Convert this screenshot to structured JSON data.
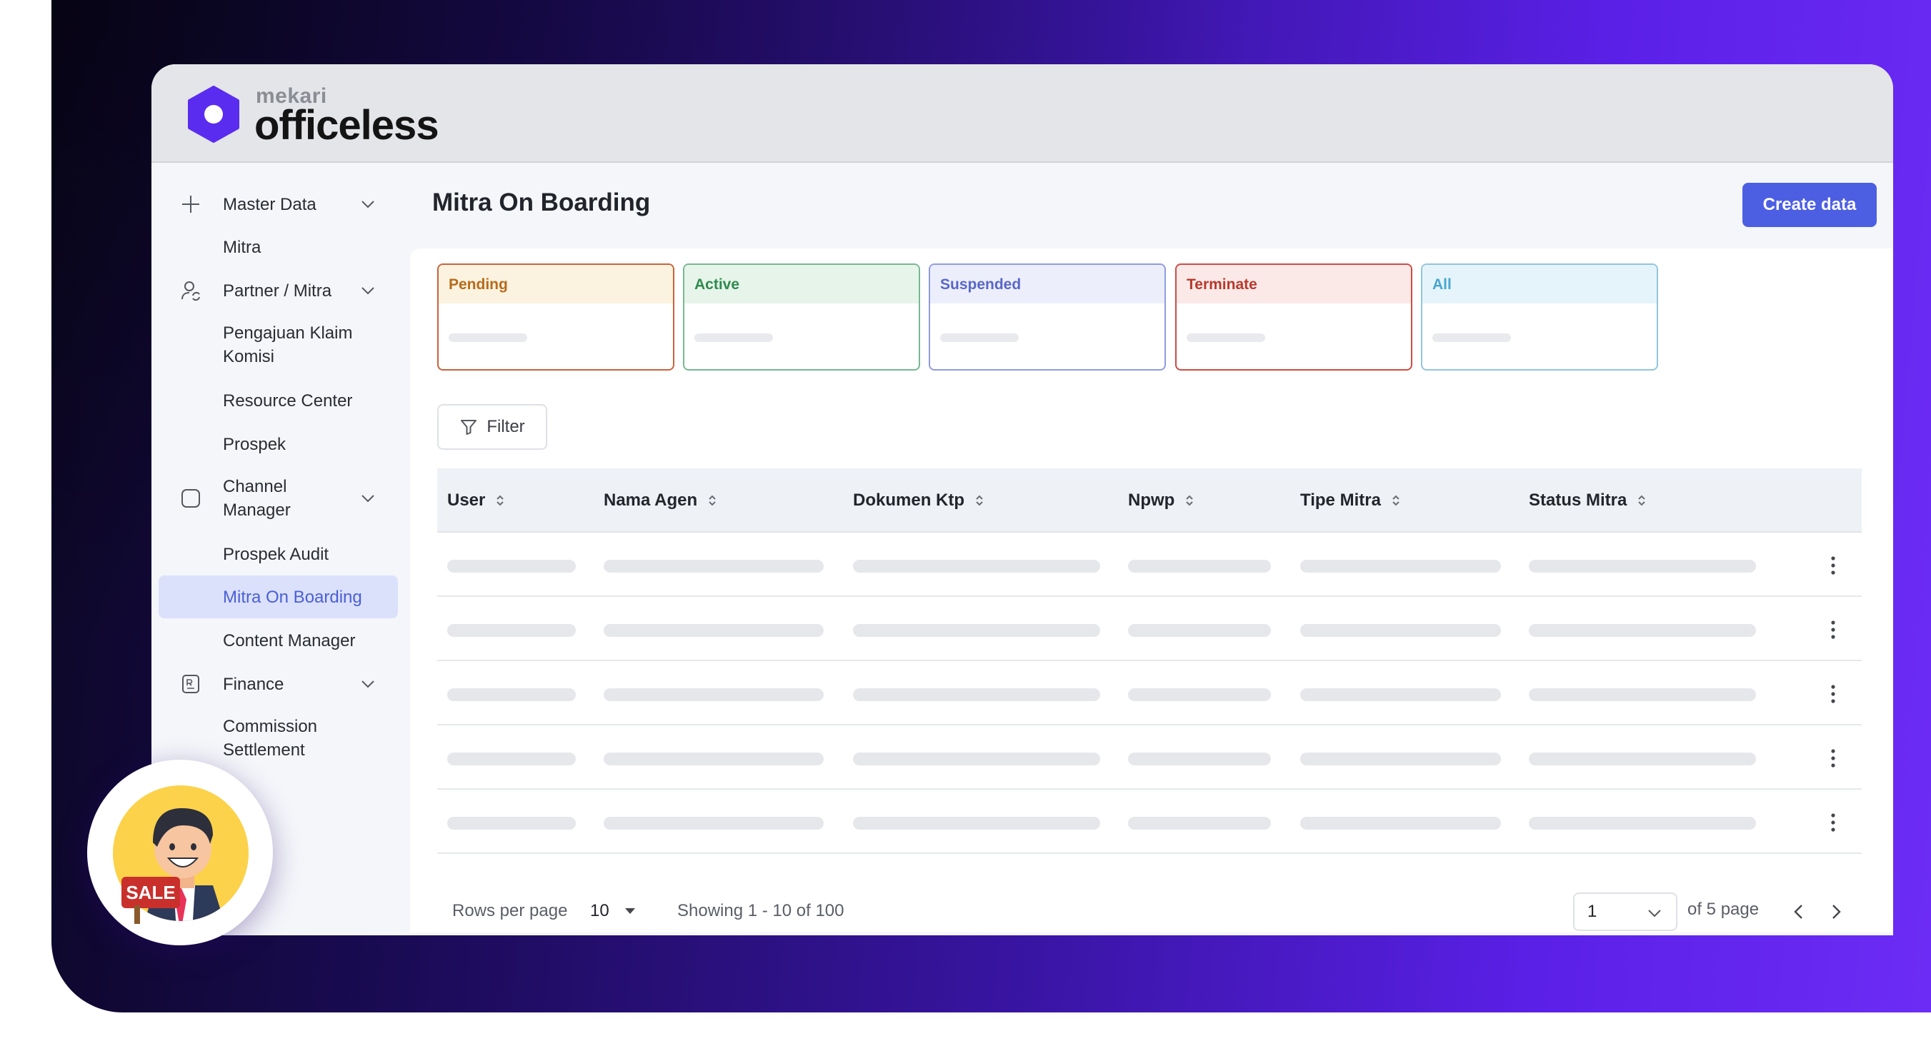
{
  "brand": {
    "small": "mekari",
    "big": "officeless"
  },
  "page": {
    "title": "Mitra On Boarding",
    "create_button": "Create data"
  },
  "sidebar": {
    "items": [
      {
        "label": "Master Data",
        "icon": "plus-icon",
        "expandable": true
      },
      {
        "label": "Mitra"
      },
      {
        "label": "Partner / Mitra",
        "icon": "user-sync-icon",
        "expandable": true
      },
      {
        "label": "Pengajuan Klaim Komisi"
      },
      {
        "label": "Resource Center"
      },
      {
        "label": "Prospek"
      },
      {
        "label": "Channel Manager",
        "icon": "document-icon",
        "expandable": true
      },
      {
        "label": "Prospek Audit"
      },
      {
        "label": "Mitra On Boarding",
        "active": true
      },
      {
        "label": "Content Manager"
      },
      {
        "label": "Finance",
        "icon": "rupiah-receipt-icon",
        "expandable": true
      },
      {
        "label": "Commission Settlement"
      }
    ]
  },
  "status_cards": [
    {
      "label": "Pending",
      "color": "#b86a1c",
      "bg": "#fbf3df",
      "border": "#c9623c"
    },
    {
      "label": "Active",
      "color": "#2f8a4e",
      "bg": "#e7f4ea",
      "border": "#77b893"
    },
    {
      "label": "Suspended",
      "color": "#5a66c9",
      "bg": "#eceffb",
      "border": "#8f9be0"
    },
    {
      "label": "Terminate",
      "color": "#b53a2c",
      "bg": "#fbe9e8",
      "border": "#cf4b45"
    },
    {
      "label": "All",
      "color": "#4aa5cf",
      "bg": "#e5f4fb",
      "border": "#93c5dd"
    }
  ],
  "filter": {
    "label": "Filter"
  },
  "table": {
    "columns": [
      "User",
      "Nama Agen",
      "Dokumen Ktp",
      "Npwp",
      "Tipe Mitra",
      "Status Mitra"
    ],
    "row_count": 5
  },
  "footer": {
    "rows_per_page_label": "Rows per page",
    "rows_per_page_value": "10",
    "showing": "Showing 1 - 10 of 100",
    "page_value": "1",
    "of_pages": "of 5 page"
  },
  "badge": {
    "sale_text": "SALE"
  },
  "colors": {
    "accent": "#4c5fe3",
    "brand_hex": "#5a2cf0"
  }
}
